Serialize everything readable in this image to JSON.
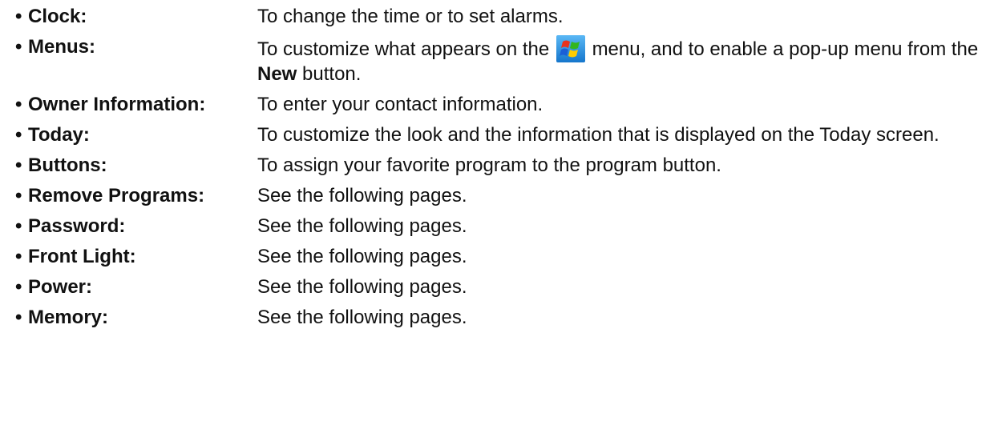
{
  "settings_list": [
    {
      "term": "Clock:",
      "desc": "To change the time or to set alarms."
    },
    {
      "term": "Menus:",
      "desc_before_icon": "To customize what appears on the",
      "icon": "windows-start-flag-icon",
      "desc_after_icon": "menu, and to enable a pop-up menu from the",
      "desc_bold": "New",
      "desc_end": "button."
    },
    {
      "term": "Owner Information:",
      "desc": "To enter your contact information."
    },
    {
      "term": "Today:",
      "desc": "To customize the look and the information that is displayed on the Today screen."
    },
    {
      "term": "Buttons:",
      "desc": "To assign your favorite program to the program button."
    },
    {
      "term": "Remove Programs:",
      "desc": "See the following pages."
    },
    {
      "term": "Password:",
      "desc": "See the following pages."
    },
    {
      "term": "Front Light:",
      "desc": "See the following pages."
    },
    {
      "term": "Power:",
      "desc": "See the following pages."
    },
    {
      "term": "Memory:",
      "desc": "See the following pages."
    }
  ],
  "bullet": "•",
  "colors": {
    "text": "#111111",
    "icon_bg": "#1f8fe0",
    "flag_red": "#e8321c",
    "flag_green": "#33b61e",
    "flag_blue": "#1b5fd6",
    "flag_yellow": "#ffcc00"
  }
}
